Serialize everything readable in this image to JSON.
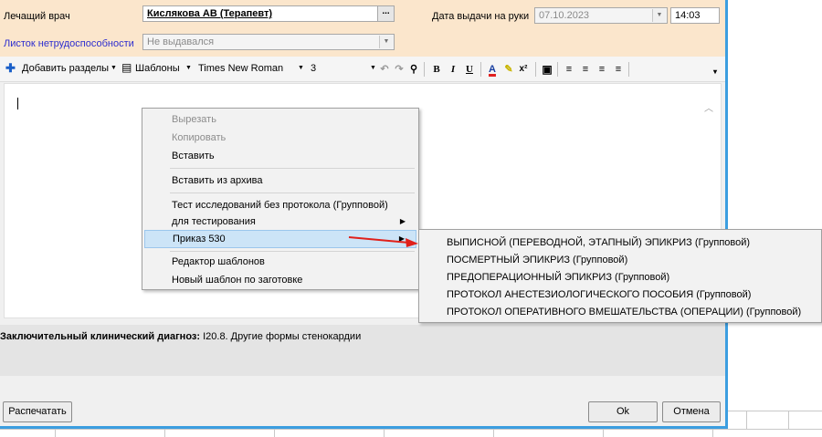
{
  "header": {
    "doctor_label": "Лечащий врач",
    "doctor_value": "Кислякова АВ (Терапевт)",
    "issue_date_label": "Дата выдачи на руки",
    "issue_date_value": "07.10.2023",
    "issue_time_value": "14:03",
    "sick_leave_label": "Листок нетрудоспособности",
    "sick_leave_value": "Не выдавался"
  },
  "toolbar": {
    "add_sections": "Добавить разделы",
    "templates": "Шаблоны",
    "font_name": "Times New Roman",
    "font_size": "3"
  },
  "context_menu": {
    "items": [
      "Вырезать",
      "Копировать",
      "Вставить",
      "Вставить из архива",
      "Тест исследований без протокола (Групповой)",
      "для тестирования",
      "Приказ 530",
      "Редактор шаблонов",
      "Новый шаблон по заготовке"
    ]
  },
  "submenu": {
    "items": [
      "ВЫПИСНОЙ (ПЕРЕВОДНОЙ, ЭТАПНЫЙ)  ЭПИКРИЗ (Групповой)",
      "ПОСМЕРТНЫЙ ЭПИКРИЗ (Групповой)",
      "ПРЕДОПЕРАЦИОННЫЙ ЭПИКРИЗ (Групповой)",
      "ПРОТОКОЛ АНЕСТЕЗИОЛОГИЧЕСКОГО ПОСОБИЯ (Групповой)",
      "ПРОТОКОЛ ОПЕРАТИВНОГО ВМЕШАТЕЛЬСТВА (ОПЕРАЦИИ) (Групповой)"
    ]
  },
  "diagnosis": {
    "label": "Заключительный клинический диагноз:",
    "value": "I20.8. Другие формы стенокардии"
  },
  "buttons": {
    "print": "Распечатать",
    "ok": "Ok",
    "cancel": "Отмена"
  },
  "colors": {
    "header_bg": "#fbe6cc",
    "accent_blue": "#3c9ee0",
    "highlight": "#cce4f7",
    "arrow_red": "#e0201a"
  }
}
